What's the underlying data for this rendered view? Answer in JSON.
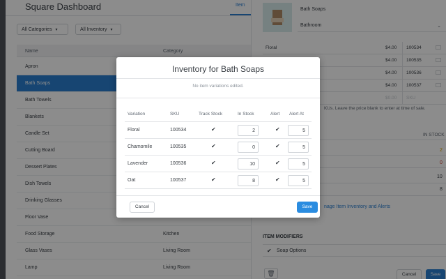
{
  "dashboard": {
    "title": "Square Dashboard",
    "tab_label": "Item",
    "filters": [
      "All Categories",
      "All Inventory"
    ],
    "columns": [
      "Name",
      "Category"
    ],
    "rows": [
      {
        "name": "Apron",
        "category": ""
      },
      {
        "name": "Bath Soaps",
        "category": ""
      },
      {
        "name": "Bath Towels",
        "category": ""
      },
      {
        "name": "Blankets",
        "category": ""
      },
      {
        "name": "Candle Set",
        "category": ""
      },
      {
        "name": "Cutting Board",
        "category": ""
      },
      {
        "name": "Dessert Plates",
        "category": ""
      },
      {
        "name": "Dish Towels",
        "category": ""
      },
      {
        "name": "Drinking Glasses",
        "category": ""
      },
      {
        "name": "Floor Vase",
        "category": ""
      },
      {
        "name": "Food Storage",
        "category": "Kitchen"
      },
      {
        "name": "Glass Vases",
        "category": "Living Room"
      },
      {
        "name": "Lamp",
        "category": "Living Room"
      }
    ]
  },
  "panel": {
    "item_name": "Bath Soaps",
    "category": "Bathroom",
    "variations": [
      {
        "name": "Floral",
        "price": "$4.00",
        "sku": "100534"
      },
      {
        "name": "",
        "price": "$4.00",
        "sku": "100535"
      },
      {
        "name": "",
        "price": "$4.00",
        "sku": "100536"
      },
      {
        "name": "",
        "price": "$4.00",
        "sku": "100537"
      },
      {
        "name": "",
        "price": "$0.00",
        "sku": "SKU"
      }
    ],
    "help_text": "KUs. Leave the price blank to enter at time of sale.",
    "in_stock_header": "IN STOCK",
    "stock_values": [
      "2",
      "0",
      "10",
      "8"
    ],
    "manage_link": "nage Item Inventory and Alerts",
    "modifiers_title": "ITEM MODIFIERS",
    "modifier_option": "Soap Options",
    "cancel_label": "Cancel",
    "save_label": "Save"
  },
  "modal": {
    "title": "Inventory for Bath Soaps",
    "notice": "No item variations edited.",
    "headers": [
      "Variation",
      "SKU",
      "Track Stock",
      "In Stock",
      "Alert",
      "Alert At"
    ],
    "rows": [
      {
        "variation": "Floral",
        "sku": "100534",
        "in_stock": "2",
        "alert_at": "5"
      },
      {
        "variation": "Chamomile",
        "sku": "100535",
        "in_stock": "0",
        "alert_at": "5"
      },
      {
        "variation": "Lavender",
        "sku": "100536",
        "in_stock": "10",
        "alert_at": "5"
      },
      {
        "variation": "Oat",
        "sku": "100537",
        "in_stock": "8",
        "alert_at": "5"
      }
    ],
    "check_glyph": "✔",
    "cancel_label": "Cancel",
    "save_label": "Save"
  },
  "colors": {
    "accent": "#2a7fd0",
    "warning": "#d8a400",
    "danger": "#cc3b2b"
  }
}
